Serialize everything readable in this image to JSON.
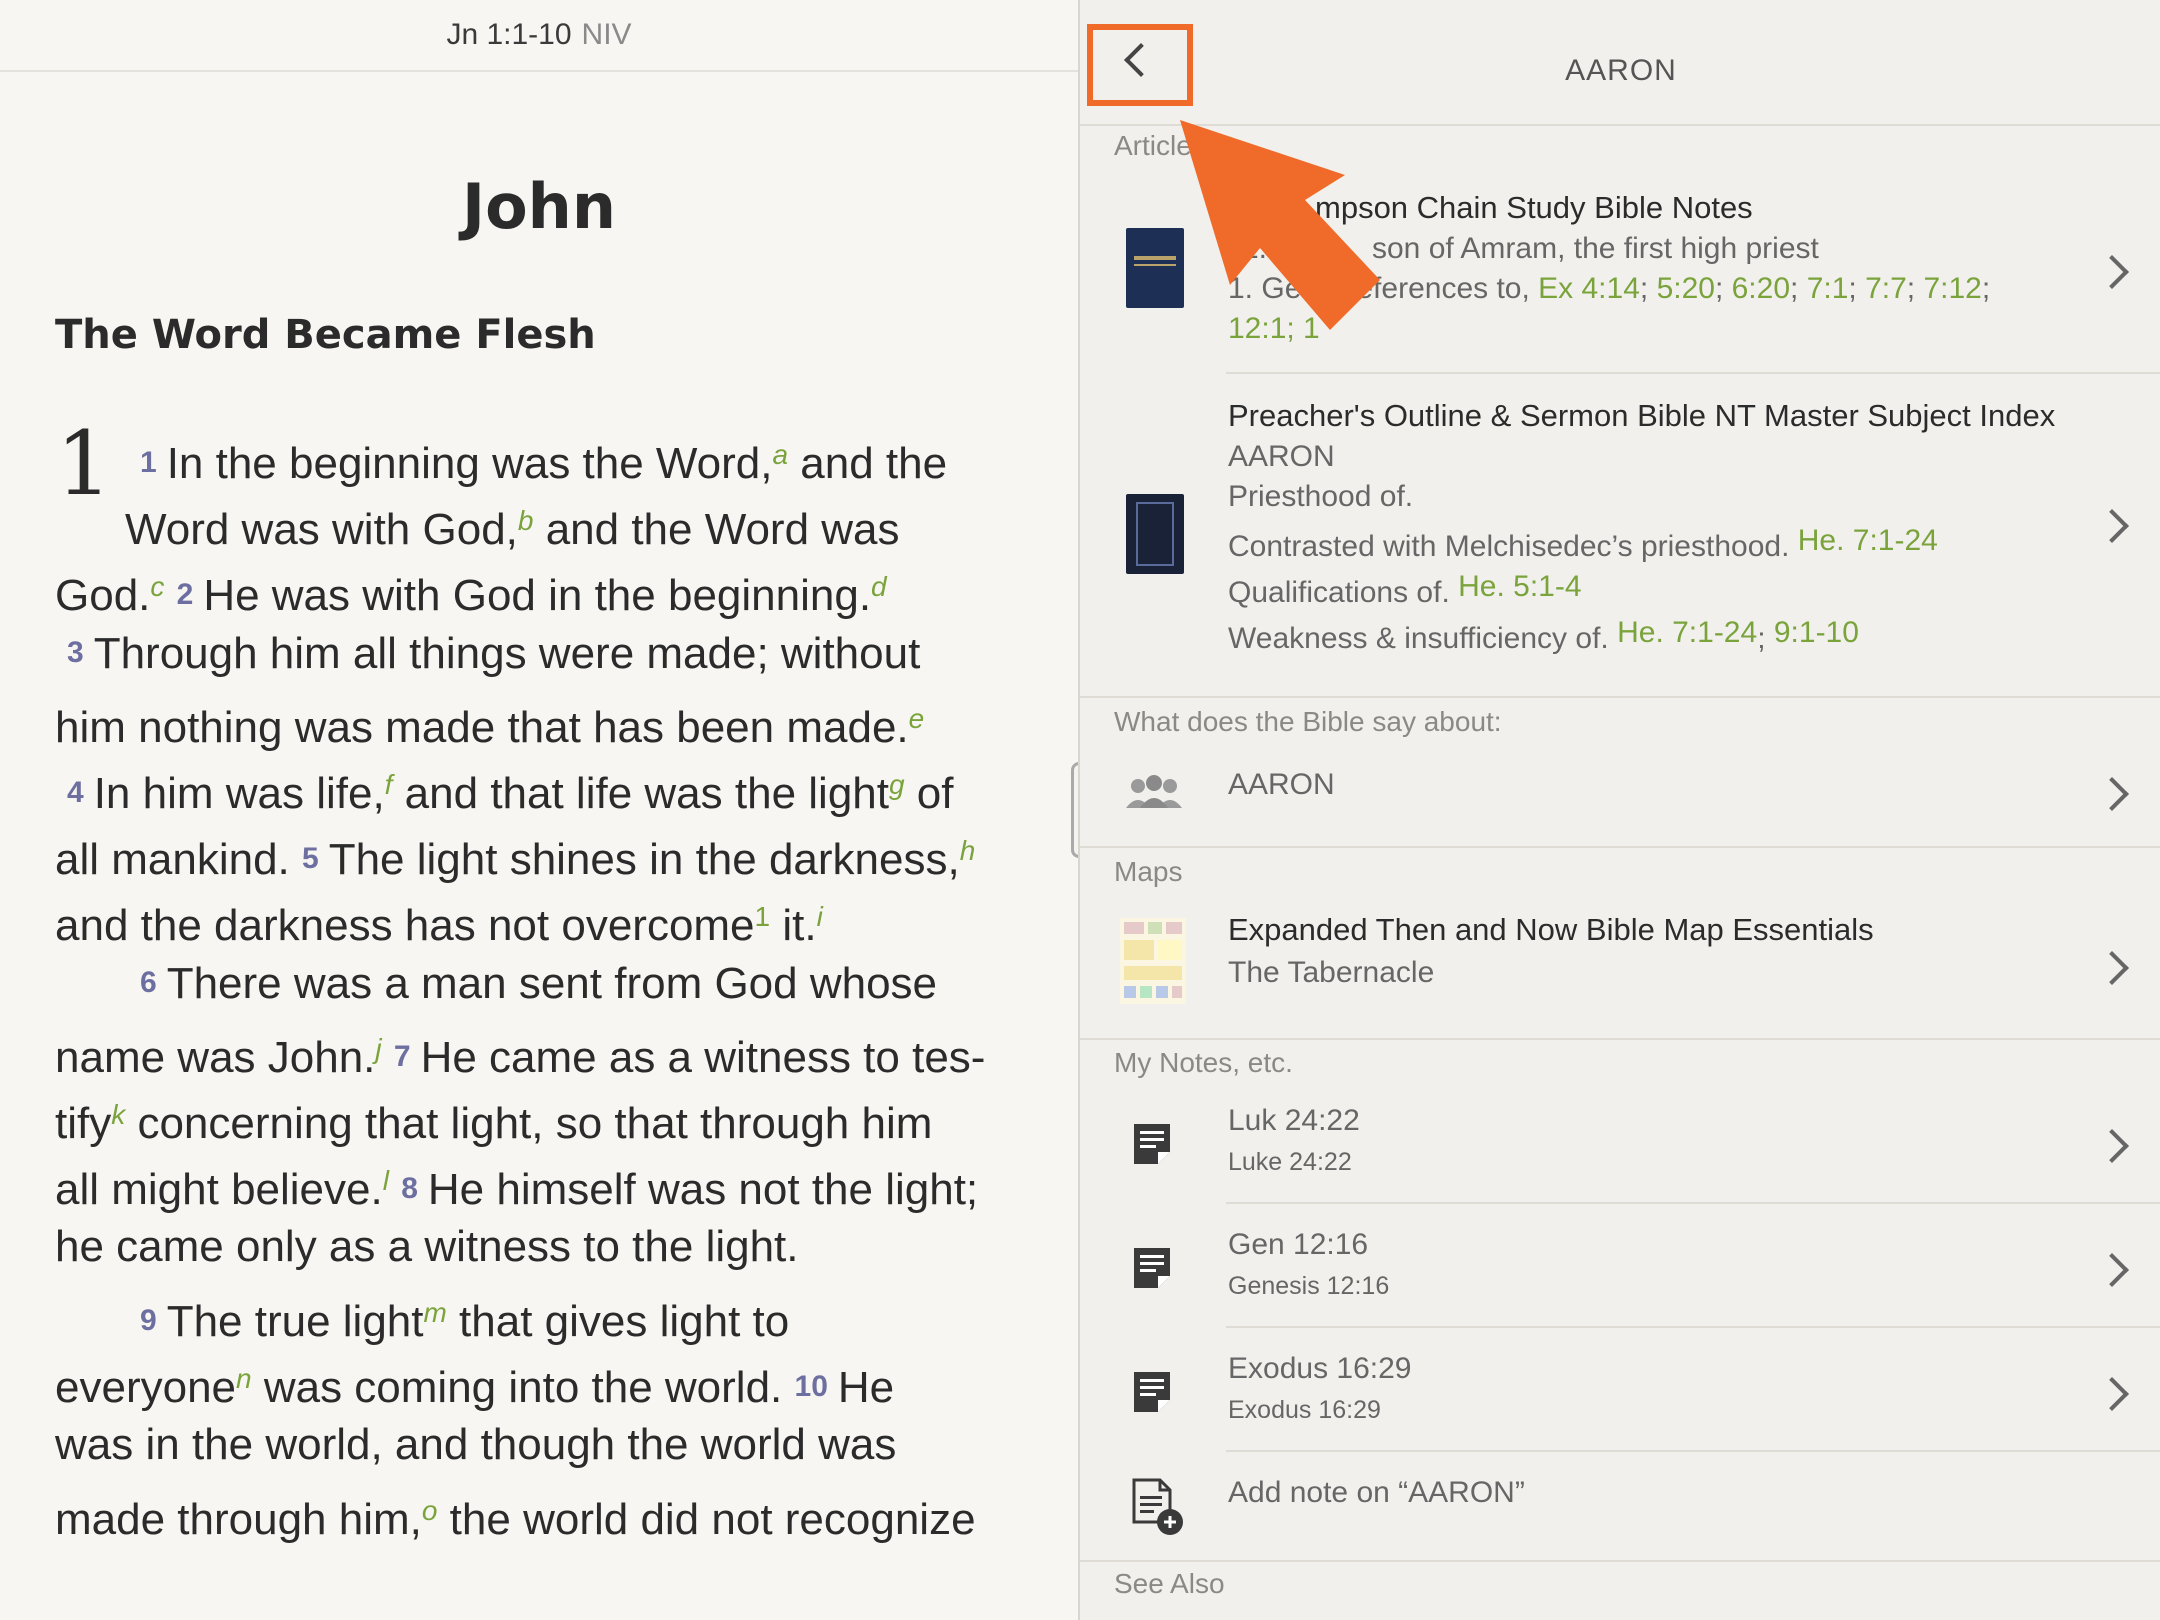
{
  "reader": {
    "reference": "Jn 1:1-10",
    "version": "NIV",
    "book_title": "John",
    "section_title": "The Word Became Flesh",
    "chapter": "1",
    "lines": [
      {
        "parts": [
          {
            "t": "v",
            "x": "1"
          },
          {
            "t": "x",
            "x": "In the beginning was the Word,"
          },
          {
            "t": "f",
            "x": "a"
          },
          {
            "t": "x",
            "x": " and the"
          }
        ]
      },
      {
        "parts": [
          {
            "t": "x",
            "x": "Word was with God,"
          },
          {
            "t": "f",
            "x": "b"
          },
          {
            "t": "x",
            "x": " and the Word was"
          }
        ]
      },
      {
        "parts": [
          {
            "t": "x",
            "x": "God."
          },
          {
            "t": "f",
            "x": "c"
          },
          {
            "t": "x",
            "x": "  "
          },
          {
            "t": "v",
            "x": "2"
          },
          {
            "t": "x",
            "x": "He was with God in the beginning."
          },
          {
            "t": "f",
            "x": "d"
          }
        ]
      },
      {
        "parts": [
          {
            "t": "v",
            "x": "3"
          },
          {
            "t": "x",
            "x": "Through him all things were made; without"
          }
        ]
      },
      {
        "parts": [
          {
            "t": "x",
            "x": "him nothing was made that has been made."
          },
          {
            "t": "f",
            "x": "e"
          }
        ]
      },
      {
        "parts": [
          {
            "t": "v",
            "x": "4"
          },
          {
            "t": "x",
            "x": "In him was life,"
          },
          {
            "t": "f",
            "x": "f"
          },
          {
            "t": "x",
            "x": " and that life was the light"
          },
          {
            "t": "f",
            "x": "g"
          },
          {
            "t": "x",
            "x": " of"
          }
        ]
      },
      {
        "parts": [
          {
            "t": "x",
            "x": "all mankind.   "
          },
          {
            "t": "v",
            "x": "5"
          },
          {
            "t": "x",
            "x": "The light shines in the darkness,"
          },
          {
            "t": "f",
            "x": "h"
          }
        ]
      },
      {
        "parts": [
          {
            "t": "x",
            "x": "and the darkness has not overcome"
          },
          {
            "t": "n",
            "x": "1"
          },
          {
            "t": "x",
            "x": " it."
          },
          {
            "t": "f",
            "x": "i"
          }
        ]
      },
      {
        "parts": [
          {
            "t": "v",
            "x": "6"
          },
          {
            "t": "x",
            "x": "There was a man sent from God whose"
          }
        ]
      },
      {
        "parts": [
          {
            "t": "x",
            "x": "name was John."
          },
          {
            "t": "f",
            "x": "j"
          },
          {
            "t": "x",
            "x": "  "
          },
          {
            "t": "v",
            "x": "7"
          },
          {
            "t": "x",
            "x": "He came as a witness to tes-"
          }
        ]
      },
      {
        "parts": [
          {
            "t": "x",
            "x": "tify"
          },
          {
            "t": "f",
            "x": "k"
          },
          {
            "t": "x",
            "x": " concerning that light, so that through him"
          }
        ]
      },
      {
        "parts": [
          {
            "t": "x",
            "x": "all might believe."
          },
          {
            "t": "f",
            "x": "l"
          },
          {
            "t": "x",
            "x": "  "
          },
          {
            "t": "v",
            "x": "8"
          },
          {
            "t": "x",
            "x": "He himself was not the light;"
          }
        ]
      },
      {
        "parts": [
          {
            "t": "x",
            "x": "he came only as a witness to the light."
          }
        ]
      },
      {
        "parts": [
          {
            "t": "v",
            "x": "9"
          },
          {
            "t": "x",
            "x": "The true light"
          },
          {
            "t": "f",
            "x": "m"
          },
          {
            "t": "x",
            "x": " that gives light to"
          }
        ]
      },
      {
        "parts": [
          {
            "t": "x",
            "x": "everyone"
          },
          {
            "t": "f",
            "x": "n"
          },
          {
            "t": "x",
            "x": " was coming into the world.   "
          },
          {
            "t": "v",
            "x": "10"
          },
          {
            "t": "x",
            "x": "He"
          }
        ]
      },
      {
        "parts": [
          {
            "t": "x",
            "x": "was in the world, and though the world was"
          }
        ]
      },
      {
        "parts": [
          {
            "t": "x",
            "x": "made through him,"
          },
          {
            "t": "f",
            "x": "o"
          },
          {
            "t": "x",
            "x": " the world did not recognize"
          }
        ]
      }
    ]
  },
  "panel": {
    "title": "AARON",
    "back_icon": "chevron-left-icon",
    "highlight_color": "#f06a2a",
    "sections": {
      "articles": "Articles",
      "what_does": "What does the Bible say about:",
      "maps": "Maps",
      "my_notes": "My Notes, etc.",
      "see_also": "See Also"
    },
    "article1": {
      "title": "Thompson Chain Study Bible Notes",
      "title_visible": "mpson Chain Study Bible Notes",
      "line1_visible": "1.",
      "line1b_visible": "son of Amram, the first high priest",
      "line2_visible": "1. Ge",
      "line2b_visible": "eferences to,",
      "refs_line2": [
        "Ex 4:14",
        "5:20",
        "6:20",
        "7:1",
        "7:7",
        "7:12"
      ],
      "line3_visible": "12:1; 1"
    },
    "article2": {
      "title": "Preacher's Outline & Sermon Bible NT Master Subject Index",
      "subtitle": "AARON",
      "line1": "Priesthood of.",
      "line2": "Contrasted with Melchisedec’s priesthood.",
      "line2_ref": "He. 7:1-24",
      "line3": "Qualifications of.",
      "line3_ref": "He. 5:1-4",
      "line4": "Weakness & insufficiency of.",
      "line4_ref1": "He. 7:1-24",
      "line4_ref2": "9:1-10"
    },
    "topic": {
      "label": "AARON"
    },
    "map": {
      "title": "Expanded Then and Now Bible Map Essentials",
      "subtitle": "The Tabernacle"
    },
    "notes": [
      {
        "title": "Luk 24:22",
        "subtitle": "Luke 24:22"
      },
      {
        "title": "Gen 12:16",
        "subtitle": "Genesis 12:16"
      },
      {
        "title": "Exodus 16:29",
        "subtitle": "Exodus 16:29"
      }
    ],
    "add_note": "Add note on “AARON”"
  }
}
